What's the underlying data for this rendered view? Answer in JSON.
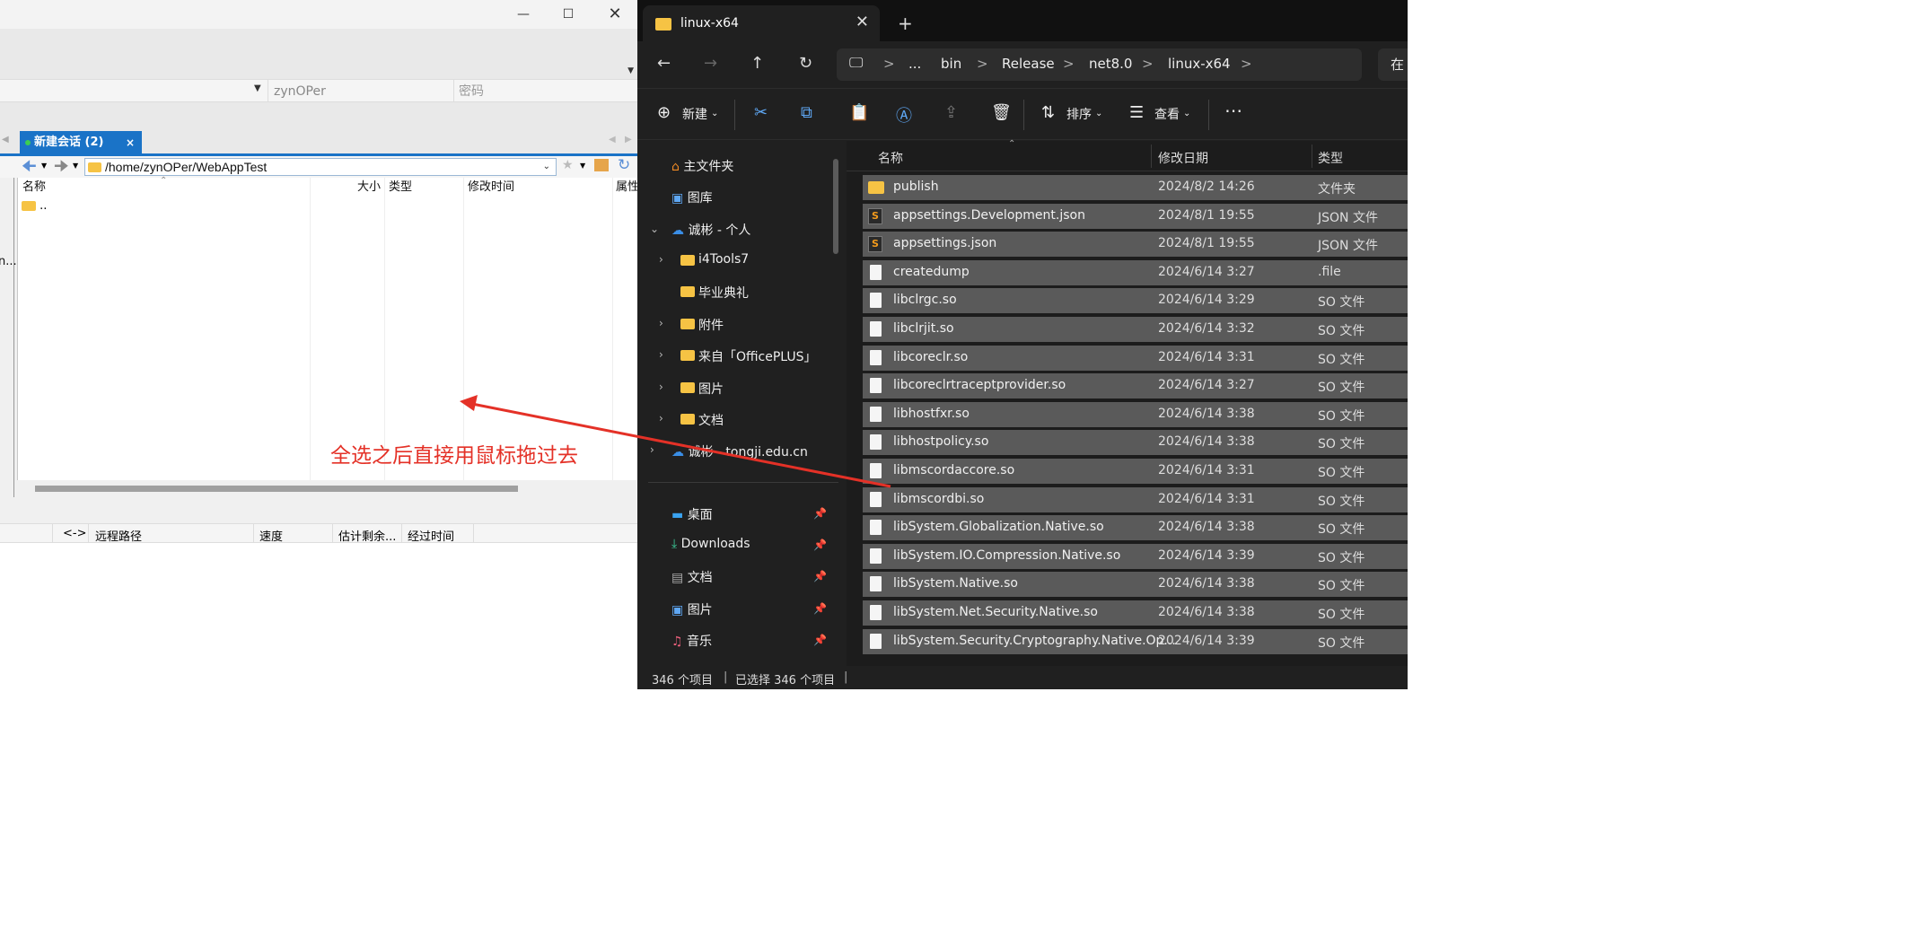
{
  "left": {
    "credentials": {
      "username": "zynOPer",
      "password_placeholder": "密码"
    },
    "tab": {
      "label": "新建会话 (2)",
      "close": "×"
    },
    "path": "/home/zynOPer/WebAppTest",
    "columns": {
      "name": "名称",
      "size": "大小",
      "type": "类型",
      "modified": "修改时间",
      "attrs": "属性"
    },
    "parent_dir": "..",
    "left_edge_text": "n...",
    "transfer_columns": {
      "dir": "<->",
      "remote_path": "远程路径",
      "speed": "速度",
      "eta": "估计剩余...",
      "elapsed": "经过时间"
    },
    "annotation": "全选之后直接用鼠标拖过去"
  },
  "right": {
    "tab_title": "linux-x64",
    "breadcrumb": [
      "...",
      "bin",
      "Release",
      "net8.0",
      "linux-x64"
    ],
    "search_label": "在",
    "commands": {
      "new": "新建",
      "sort": "排序",
      "view": "查看",
      "more": "⋯"
    },
    "sidebar": {
      "home": "主文件夹",
      "gallery": "图库",
      "onedrive_personal": "诚彬 - 个人",
      "folders": [
        {
          "label": "i4Tools7"
        },
        {
          "label": "毕业典礼"
        },
        {
          "label": "附件"
        },
        {
          "label": "来自「OfficePLUS」"
        },
        {
          "label": "图片"
        },
        {
          "label": "文档"
        }
      ],
      "onedrive_work": "诚彬 - tongji.edu.cn",
      "pinned": [
        {
          "label": "桌面"
        },
        {
          "label": "Downloads"
        },
        {
          "label": "文档"
        },
        {
          "label": "图片"
        },
        {
          "label": "音乐"
        }
      ]
    },
    "columns": {
      "name": "名称",
      "modified": "修改日期",
      "type": "类型"
    },
    "files": [
      {
        "name": "publish",
        "date": "2024/8/2 14:26",
        "type": "文件夹",
        "icon": "folder"
      },
      {
        "name": "appsettings.Development.json",
        "date": "2024/8/1 19:55",
        "type": "JSON 文件",
        "icon": "json"
      },
      {
        "name": "appsettings.json",
        "date": "2024/8/1 19:55",
        "type": "JSON 文件",
        "icon": "json"
      },
      {
        "name": "createdump",
        "date": "2024/6/14 3:27",
        "type": ".file",
        "icon": "file"
      },
      {
        "name": "libclrgc.so",
        "date": "2024/6/14 3:29",
        "type": "SO 文件",
        "icon": "file"
      },
      {
        "name": "libclrjit.so",
        "date": "2024/6/14 3:32",
        "type": "SO 文件",
        "icon": "file"
      },
      {
        "name": "libcoreclr.so",
        "date": "2024/6/14 3:31",
        "type": "SO 文件",
        "icon": "file"
      },
      {
        "name": "libcoreclrtraceptprovider.so",
        "date": "2024/6/14 3:27",
        "type": "SO 文件",
        "icon": "file"
      },
      {
        "name": "libhostfxr.so",
        "date": "2024/6/14 3:38",
        "type": "SO 文件",
        "icon": "file"
      },
      {
        "name": "libhostpolicy.so",
        "date": "2024/6/14 3:38",
        "type": "SO 文件",
        "icon": "file"
      },
      {
        "name": "libmscordaccore.so",
        "date": "2024/6/14 3:31",
        "type": "SO 文件",
        "icon": "file"
      },
      {
        "name": "libmscordbi.so",
        "date": "2024/6/14 3:31",
        "type": "SO 文件",
        "icon": "file"
      },
      {
        "name": "libSystem.Globalization.Native.so",
        "date": "2024/6/14 3:38",
        "type": "SO 文件",
        "icon": "file"
      },
      {
        "name": "libSystem.IO.Compression.Native.so",
        "date": "2024/6/14 3:39",
        "type": "SO 文件",
        "icon": "file"
      },
      {
        "name": "libSystem.Native.so",
        "date": "2024/6/14 3:38",
        "type": "SO 文件",
        "icon": "file"
      },
      {
        "name": "libSystem.Net.Security.Native.so",
        "date": "2024/6/14 3:38",
        "type": "SO 文件",
        "icon": "file"
      },
      {
        "name": "libSystem.Security.Cryptography.Native.Op...",
        "date": "2024/6/14 3:39",
        "type": "SO 文件",
        "icon": "file"
      }
    ],
    "status": {
      "count": "346 个项目",
      "selected": "已选择 346 个项目"
    }
  }
}
